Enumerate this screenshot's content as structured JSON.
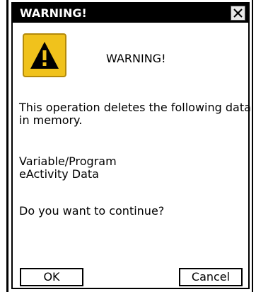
{
  "dialog": {
    "title": "WARNING!",
    "heading": "WARNING!",
    "message_line1": "This operation deletes the following data",
    "message_line2": "in memory.",
    "item1": "Variable/Program",
    "item2": "eActivity Data",
    "question": "Do you want to continue?",
    "ok_label": "OK",
    "cancel_label": "Cancel"
  },
  "icons": {
    "close": "close-icon",
    "warning": "warning-icon"
  },
  "colors": {
    "titlebar": "#000000",
    "warning_fill": "#f0c21c"
  }
}
